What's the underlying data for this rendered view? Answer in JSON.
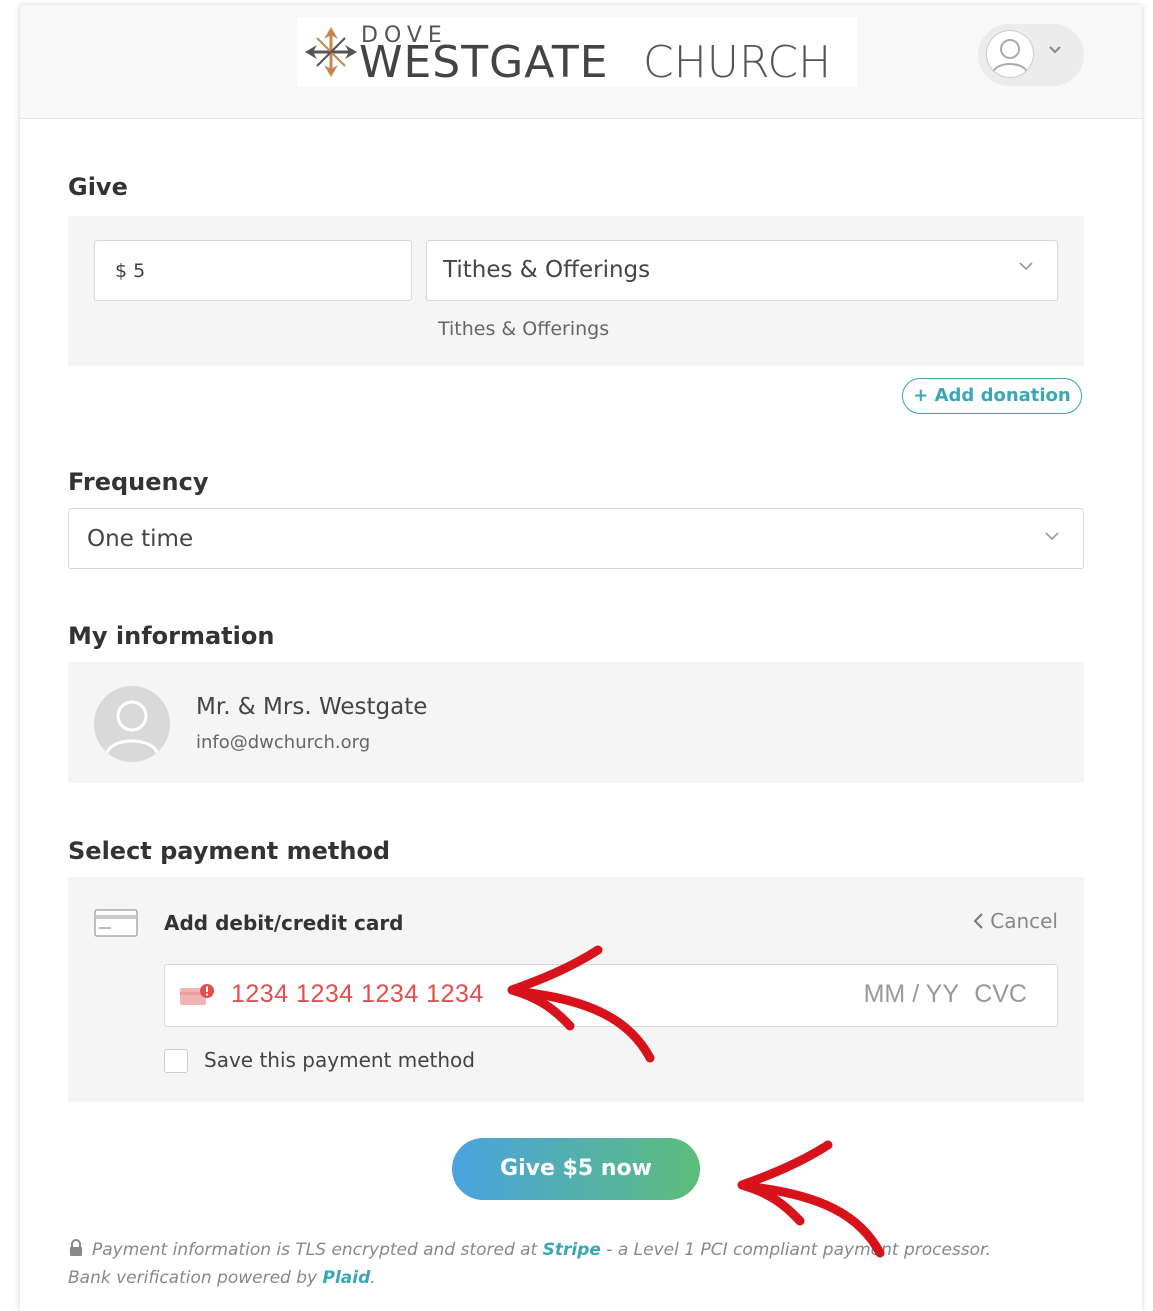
{
  "header": {
    "logo": {
      "top_word": "DOVE",
      "main_word": "WESTGATE",
      "suffix": "CHURCH"
    }
  },
  "give": {
    "title": "Give",
    "amount_value": "$ 5",
    "fund_selected": "Tithes & Offerings",
    "fund_caption": "Tithes & Offerings",
    "add_donation_label": "+ Add donation"
  },
  "frequency": {
    "title": "Frequency",
    "selected": "One time"
  },
  "my_information": {
    "title": "My information",
    "name": "Mr. & Mrs. Westgate",
    "email": "info@dwchurch.org"
  },
  "payment": {
    "title": "Select payment method",
    "add_card_label": "Add debit/credit card",
    "cancel_label": "Cancel",
    "card_number_placeholder": "1234 1234 1234 1234",
    "expiry_placeholder": "MM / YY",
    "cvc_placeholder": "CVC",
    "save_label": "Save this payment method",
    "save_checked": false
  },
  "submit": {
    "label": "Give $5 now"
  },
  "footer": {
    "text_1": "Payment information is TLS encrypted and stored at ",
    "stripe": "Stripe",
    "text_2": " - a Level 1 PCI compliant payment processor. Bank verification powered by ",
    "plaid": "Plaid",
    "text_3": "."
  },
  "colors": {
    "accent_teal": "#3aa7b5",
    "error_red": "#e44d4d",
    "button_gradient_start": "#4aa3e0",
    "button_gradient_end": "#5cbd7a",
    "annotation_arrow": "#d8121a"
  }
}
